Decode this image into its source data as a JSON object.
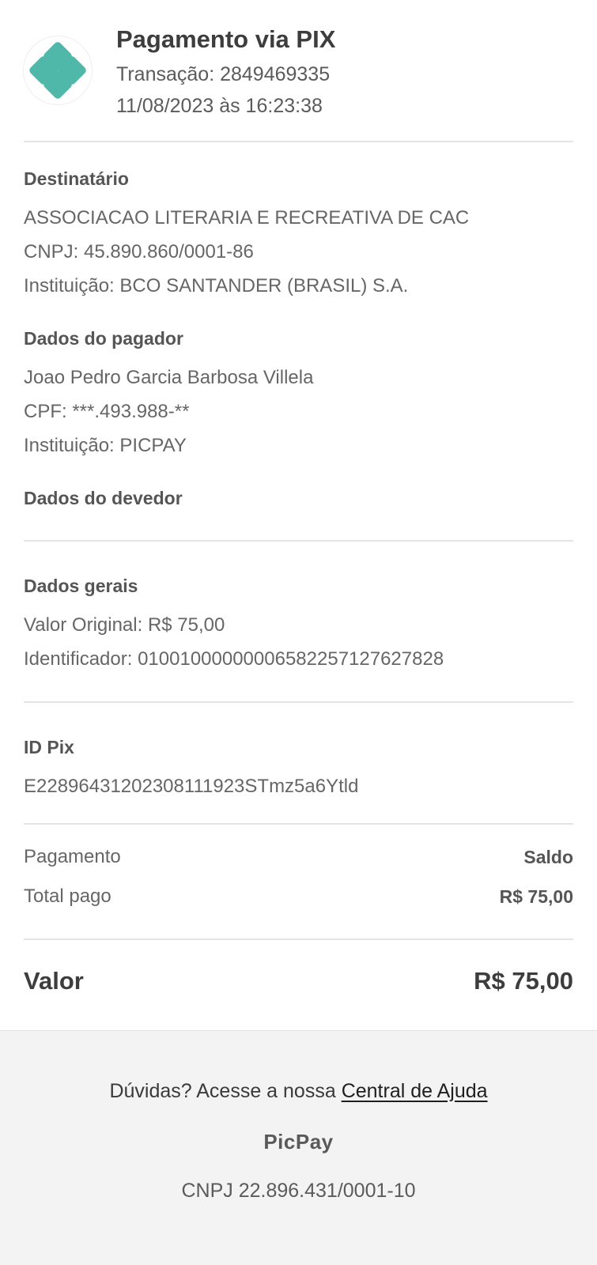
{
  "header": {
    "title": "Pagamento via PIX",
    "transaction": "Transação: 2849469335",
    "datetime": "11/08/2023 às 16:23:38",
    "logo_icon": "pix-logo-icon",
    "logo_color": "#4fb8a8"
  },
  "recipient": {
    "title": "Destinatário",
    "name": "ASSOCIACAO LITERARIA E RECREATIVA DE CAC",
    "document": "CNPJ: 45.890.860/0001-86",
    "institution": "Instituição: BCO SANTANDER (BRASIL) S.A."
  },
  "payer": {
    "title": "Dados do pagador",
    "name": "Joao Pedro Garcia Barbosa Villela",
    "document": "CPF: ***.493.988-**",
    "institution": "Instituição: PICPAY"
  },
  "debtor": {
    "title": "Dados do devedor"
  },
  "general": {
    "title": "Dados gerais",
    "original_value": "Valor Original: R$ 75,00",
    "identifier": "Identificador: 01001000000006582257127627828"
  },
  "pix_id": {
    "title": "ID Pix",
    "value": "E22896431202308111923STmz5a6Ytld"
  },
  "payment": {
    "method_label": "Pagamento",
    "method_value": "Saldo",
    "total_label": "Total pago",
    "total_value": "R$ 75,00"
  },
  "total": {
    "label": "Valor",
    "value": "R$ 75,00"
  },
  "footer": {
    "help_prefix": "Dúvidas? Acesse a nossa ",
    "help_link": "Central de Ajuda",
    "brand": "PicPay",
    "cnpj": "CNPJ 22.896.431/0001-10"
  }
}
